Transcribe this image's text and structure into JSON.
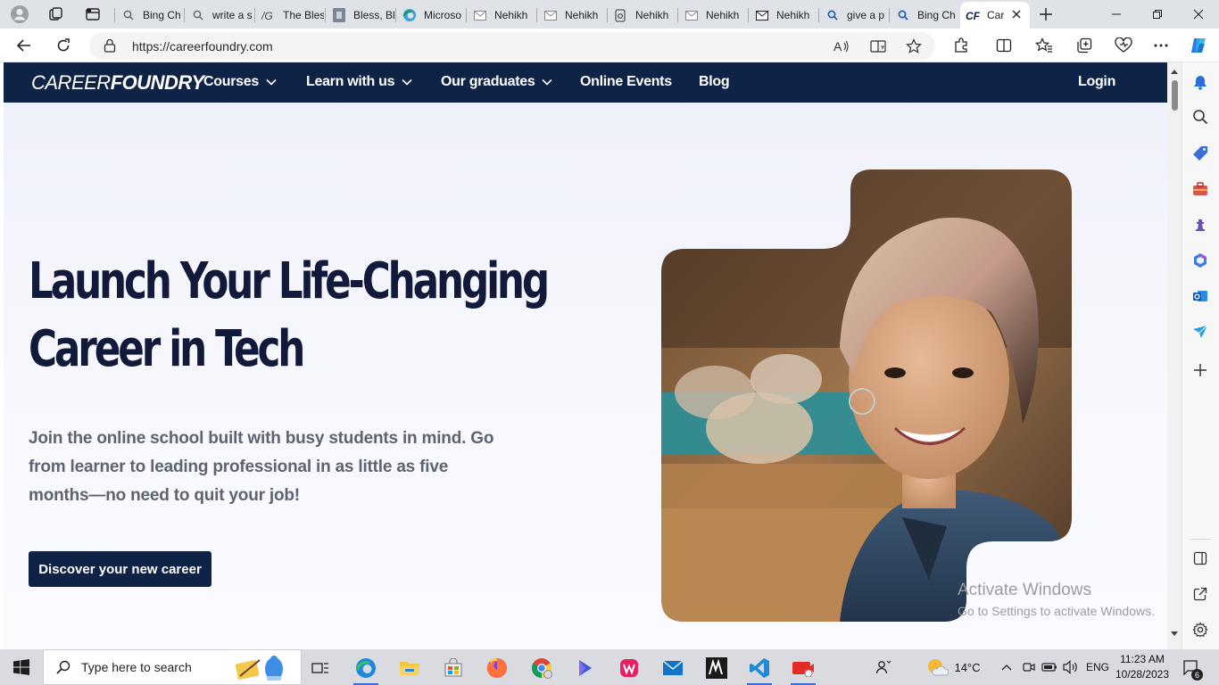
{
  "browser": {
    "tabs": [
      {
        "title": "Bing Ch",
        "icon": "search-icon"
      },
      {
        "title": "write a s",
        "icon": "search-icon"
      },
      {
        "title": "The Bles",
        "icon": "ng-logo-icon"
      },
      {
        "title": "Bless, Bl",
        "icon": "document-icon"
      },
      {
        "title": "Microso",
        "icon": "edge-icon"
      },
      {
        "title": "Nehikh",
        "icon": "mail-icon"
      },
      {
        "title": "Nehikh",
        "icon": "mail-icon"
      },
      {
        "title": "Nehikh",
        "icon": "extension-icon"
      },
      {
        "title": "Nehikh",
        "icon": "mail-icon"
      },
      {
        "title": "Nehikh",
        "icon": "mail-icon"
      },
      {
        "title": "give a p",
        "icon": "search-icon"
      },
      {
        "title": "Bing Ch",
        "icon": "search-icon"
      },
      {
        "title": "Car",
        "icon": "careerfoundry-icon",
        "active": true
      }
    ],
    "url": "https://careerfoundry.com"
  },
  "site": {
    "logo": {
      "part1": "CAREER",
      "part2": "FOUNDRY"
    },
    "nav": {
      "courses": "Courses",
      "learn": "Learn with us",
      "graduates": "Our graduates",
      "events": "Online Events",
      "blog": "Blog",
      "login": "Login"
    },
    "hero": {
      "title_line1": "Launch Your Life-Changing",
      "title_line2": "Career in Tech",
      "subtitle": "Join the online school built with busy students in mind. Go from learner to leading professional in as little as five months—no need to quit your job!",
      "cta": "Discover your new career"
    },
    "colors": {
      "navy": "#0f2347",
      "heading": "#121a3b",
      "body_text": "#5d6373"
    }
  },
  "watermark": {
    "line1": "Activate Windows",
    "line2": "Go to Settings to activate Windows."
  },
  "taskbar": {
    "search_placeholder": "Type here to search",
    "weather": "14°C",
    "language": "ENG",
    "time": "11:23 AM",
    "date": "10/28/2023",
    "notifications": "6"
  }
}
